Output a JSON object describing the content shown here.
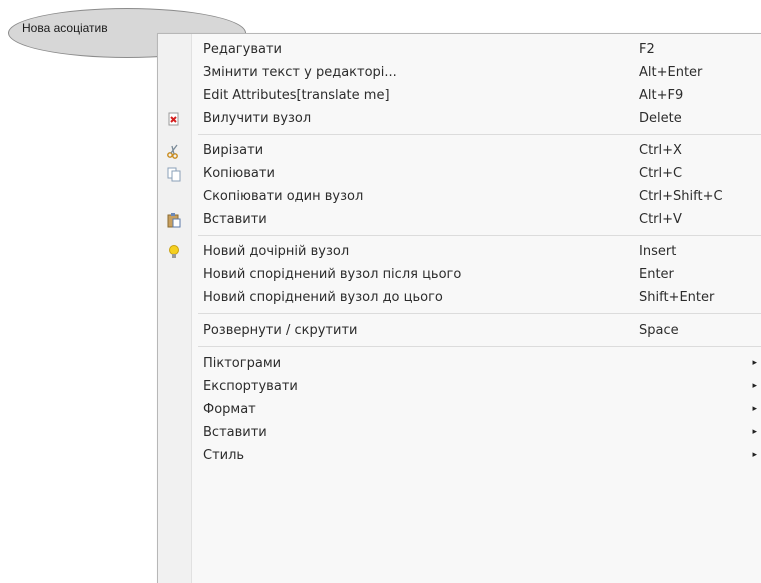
{
  "node": {
    "label": "Нова асоціатив",
    "icon": "mindmap-node"
  },
  "menu": {
    "group1": [
      {
        "label": "Редагувати",
        "shortcut": "F2",
        "icon": ""
      },
      {
        "label": "Змінити текст у редакторі...",
        "shortcut": "Alt+Enter",
        "icon": ""
      },
      {
        "label": "Edit Attributes[translate me]",
        "shortcut": "Alt+F9",
        "icon": ""
      },
      {
        "label": "Вилучити вузол",
        "shortcut": "Delete",
        "icon": "delete-node-icon"
      }
    ],
    "group2": [
      {
        "label": "Вирізати",
        "shortcut": "Ctrl+X",
        "icon": "cut-icon"
      },
      {
        "label": "Копіювати",
        "shortcut": "Ctrl+C",
        "icon": "copy-icon"
      },
      {
        "label": "Скопіювати один вузол",
        "shortcut": "Ctrl+Shift+C",
        "icon": ""
      },
      {
        "label": "Вставити",
        "shortcut": "Ctrl+V",
        "icon": "paste-icon"
      }
    ],
    "group3": [
      {
        "label": "Новий дочірній вузол",
        "shortcut": "Insert",
        "icon": "new-child-node-icon"
      },
      {
        "label": "Новий споріднений вузол після цього",
        "shortcut": "Enter",
        "icon": ""
      },
      {
        "label": "Новий споріднений вузол до цього",
        "shortcut": "Shift+Enter",
        "icon": ""
      }
    ],
    "group4": [
      {
        "label": "Розвернути / скрутити",
        "shortcut": "Space",
        "icon": ""
      }
    ],
    "group5": [
      {
        "label": "Піктограми",
        "submenu_arrow": "▸"
      },
      {
        "label": "Експортувати",
        "submenu_arrow": "▸"
      },
      {
        "label": "Формат",
        "submenu_arrow": "▸"
      },
      {
        "label": "Вставити",
        "submenu_arrow": "▸"
      },
      {
        "label": "Стиль",
        "submenu_arrow": "▸"
      }
    ]
  },
  "colors": {
    "menu_bg": "#f8f8f8",
    "icon_column": "#f1f1f1",
    "node_fill": "#d7d7d7",
    "text": "#2c2c2c"
  }
}
